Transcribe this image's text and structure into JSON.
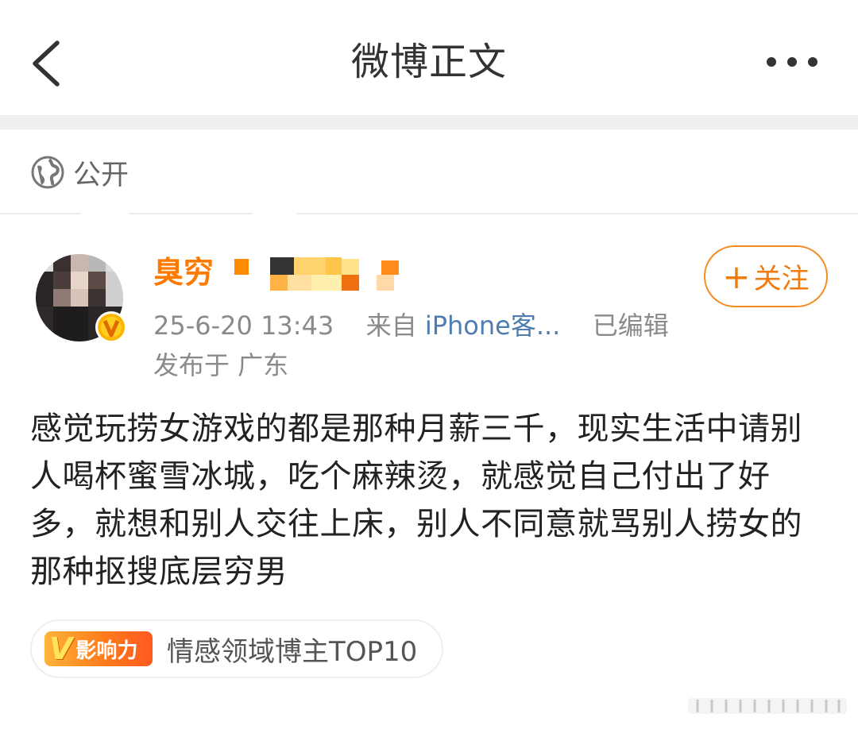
{
  "header": {
    "title": "微博正文",
    "back_icon": "chevron-left-icon",
    "more_icon": "more-dots-icon"
  },
  "visibility": {
    "icon": "globe-icon",
    "label": "公开"
  },
  "post": {
    "author": {
      "name": "臭穷",
      "avatar_icon": "avatar-pixelated",
      "badge_icon": "vip-badge-icon"
    },
    "follow_button": "+关注",
    "follow_plus": "+",
    "follow_text": "关注",
    "time": "25-6-20 13:43",
    "source_prefix": "来自",
    "source": "iPhone客...",
    "edited": "已编辑",
    "location": "发布于 广东",
    "content": "感觉玩捞女游戏的都是那种月薪三千，现实生活中请别人喝杯蜜雪冰城，吃个麻辣烫，就感觉自己付出了好多，就想和别人交往上床，别人不同意就骂别人捞女的那种抠搜底层穷男",
    "influence": {
      "badge_letter": "V",
      "badge_label": "影响力",
      "text": "情感领域博主TOP10"
    }
  },
  "colors": {
    "accent_orange": "#ff7a00",
    "link_blue": "#507daf",
    "meta_gray": "#8a8a8a"
  }
}
